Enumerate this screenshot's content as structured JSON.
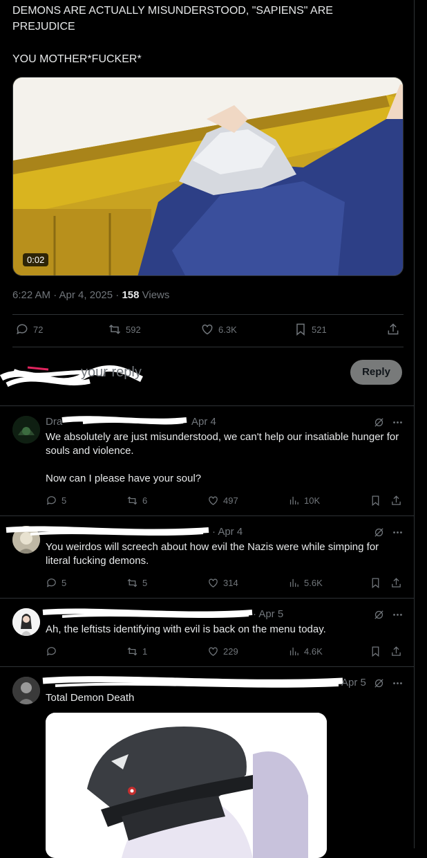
{
  "tweet": {
    "line1": "DEMONS ARE ACTUALLY MISUNDERSTOOD, \"SAPIENS\" ARE PREJUDICE",
    "line2": "YOU MOTHER*FUCKER*",
    "video_duration": "0:02",
    "time": "6:22 AM · Apr 4, 2025 · ",
    "views_count": "158",
    "views_label": " Views",
    "replies": "72",
    "reposts": "592",
    "likes": "6.3K",
    "bookmarks": "521"
  },
  "composer": {
    "placeholder": "your reply",
    "reply_label": "Reply"
  },
  "replies": [
    {
      "name_fragment": "Dra",
      "date": "Apr 4",
      "text": [
        "We absolutely are just misunderstood, we can't help our insatiable hunger for souls and violence.",
        "Now can I please have your soul?"
      ],
      "replies": "5",
      "reposts": "6",
      "likes": "497",
      "views": "10K"
    },
    {
      "name_fragment": "",
      "date": "· Apr 4",
      "text": [
        "You weirdos will screech about how evil the Nazis were while simping for literal fucking demons."
      ],
      "replies": "5",
      "reposts": "5",
      "likes": "314",
      "views": "5.6K"
    },
    {
      "name_fragment": "",
      "date": "· Apr 5",
      "text": [
        "Ah, the leftists identifying with evil is back on the menu today."
      ],
      "replies": "",
      "reposts": "1",
      "likes": "229",
      "views": "4.6K"
    },
    {
      "name_fragment": "",
      "date": "Apr 5",
      "text": [
        "Total Demon Death"
      ],
      "replies": "",
      "reposts": "",
      "likes": "",
      "views": ""
    }
  ],
  "icons": [
    "reply-icon",
    "repost-icon",
    "like-icon",
    "bookmark-icon",
    "share-icon",
    "grok-icon",
    "more-icon",
    "views-icon"
  ]
}
